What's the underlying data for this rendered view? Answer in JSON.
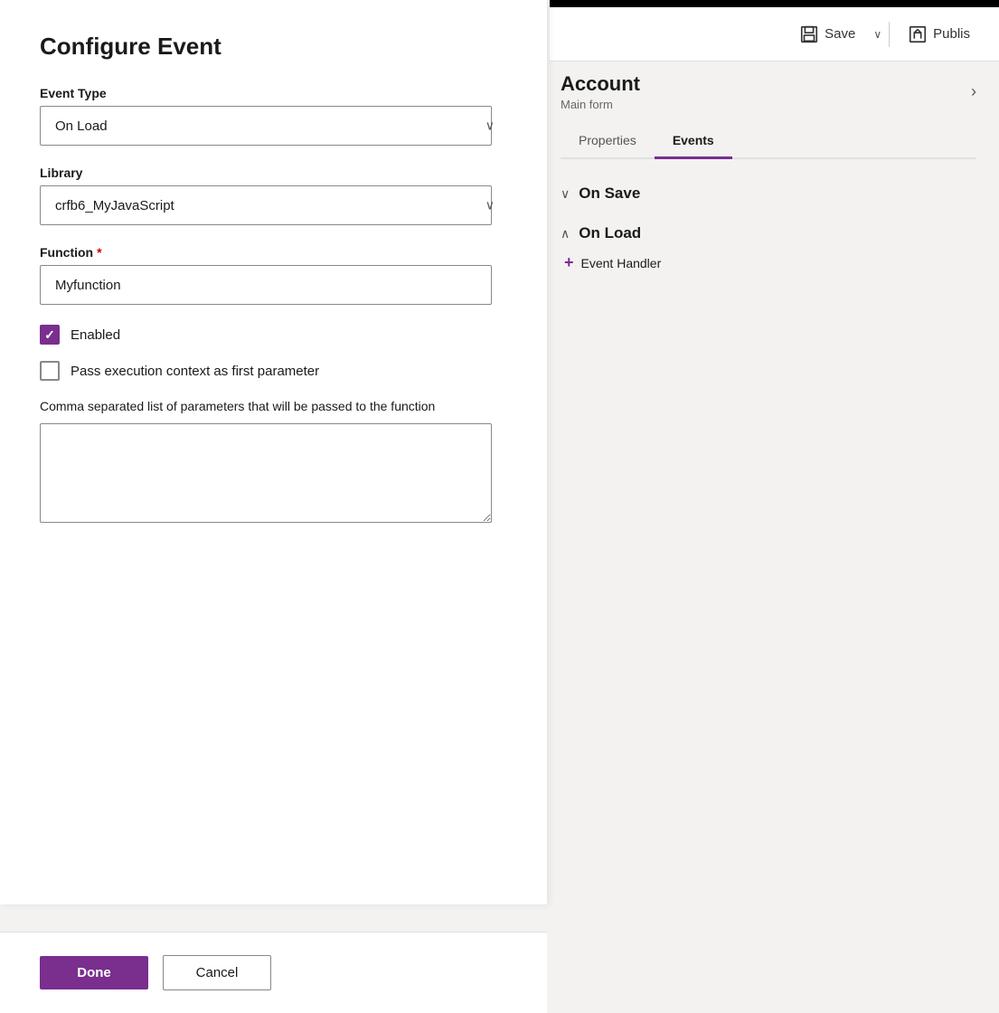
{
  "dialog": {
    "title": "Configure Event",
    "event_type_label": "Event Type",
    "event_type_value": "On Load",
    "library_label": "Library",
    "library_value": "crfb6_MyJavaScript",
    "function_label": "Function",
    "function_required": "*",
    "function_value": "Myfunction",
    "enabled_label": "Enabled",
    "enabled_checked": true,
    "pass_context_label": "Pass execution context as first parameter",
    "pass_context_checked": false,
    "params_label": "Comma separated list of parameters that will be passed to the function",
    "params_value": "",
    "done_label": "Done",
    "cancel_label": "Cancel"
  },
  "toolbar": {
    "save_label": "Save",
    "publish_label": "Publis"
  },
  "account": {
    "title": "Account",
    "subtitle": "Main form"
  },
  "tabs": [
    {
      "label": "Properties",
      "active": false
    },
    {
      "label": "Events",
      "active": true
    }
  ],
  "events": [
    {
      "title": "On Save",
      "collapsed": true,
      "icon": "chevron-down"
    },
    {
      "title": "On Load",
      "collapsed": false,
      "icon": "chevron-up"
    }
  ],
  "event_handler_label": "+ Event Handler",
  "icons": {
    "chevron_right": "›",
    "chevron_down": "∨",
    "chevron_up": "∧",
    "checkmark": "✓",
    "plus": "+"
  }
}
